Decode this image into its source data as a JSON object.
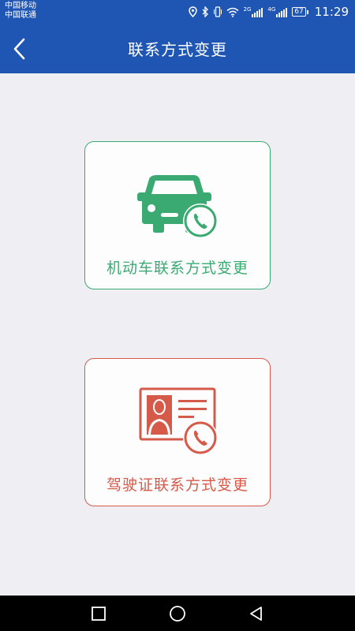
{
  "status_bar": {
    "carrier_1": "中国移动",
    "carrier_2": "中国联通",
    "network_1": "2G",
    "network_2": "4G",
    "battery": "67",
    "time": "11:29",
    "icons": [
      "location-icon",
      "bluetooth-icon",
      "vibrate-icon",
      "wifi-icon",
      "signal-icon",
      "signal-icon",
      "battery-icon"
    ]
  },
  "header": {
    "title": "联系方式变更",
    "back_icon": "chevron-left-icon",
    "color": "#1f56b3"
  },
  "options": [
    {
      "label": "机动车联系方式变更",
      "icon": "car-phone-icon",
      "color": "#3aaa72"
    },
    {
      "label": "驾驶证联系方式变更",
      "icon": "license-phone-icon",
      "color": "#d55a4a"
    }
  ],
  "nav_bar": {
    "icons": [
      "recent-apps-icon",
      "home-icon",
      "back-icon"
    ]
  }
}
